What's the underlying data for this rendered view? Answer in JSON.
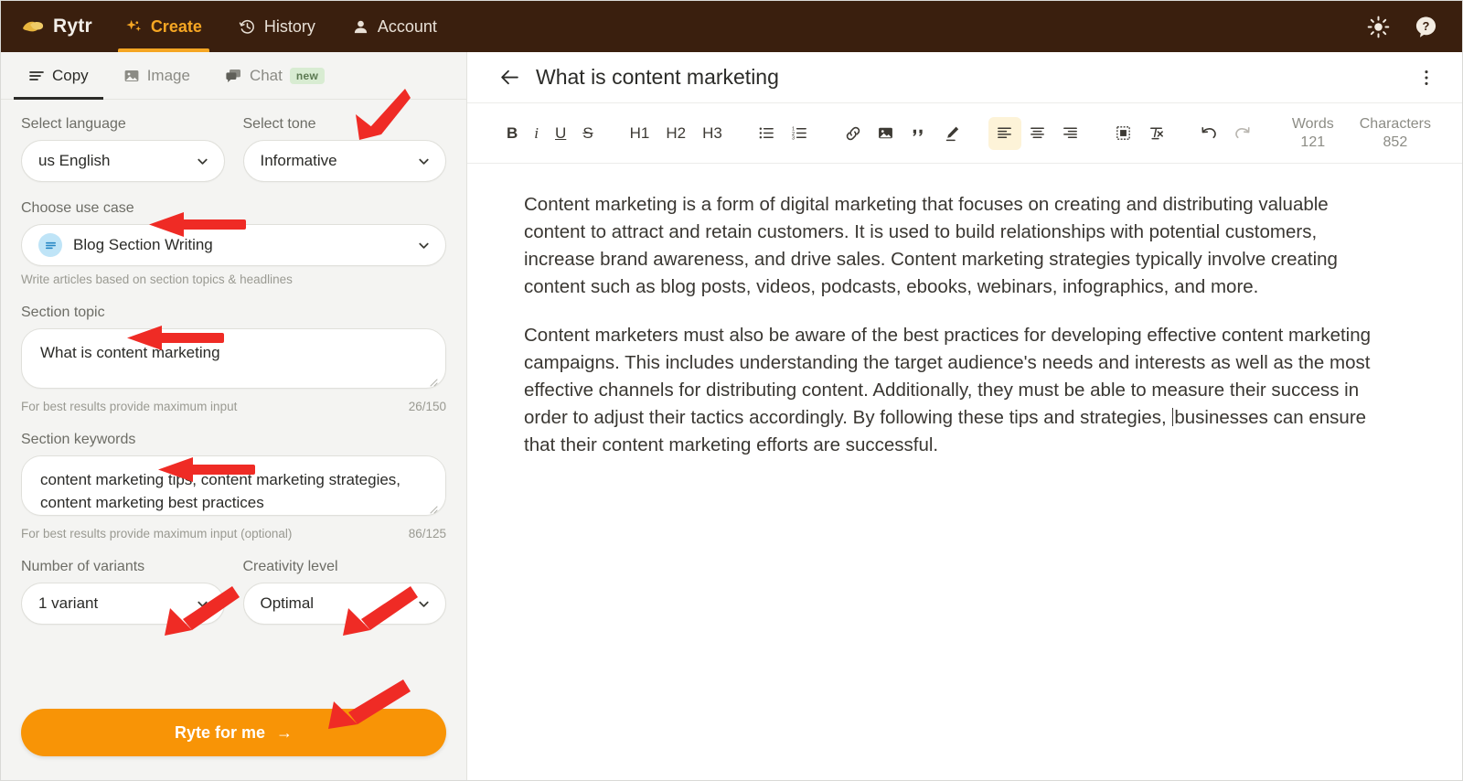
{
  "topnav": {
    "brand": "Rytr",
    "brand_icon": "rytr-logo-icon",
    "items": [
      {
        "label": "Create",
        "icon": "sparkle-icon",
        "active": true
      },
      {
        "label": "History",
        "icon": "clock-history-icon",
        "active": false
      },
      {
        "label": "Account",
        "icon": "person-icon",
        "active": false
      }
    ],
    "right_icons": [
      {
        "name": "sun-theme-icon"
      },
      {
        "name": "help-question-icon"
      }
    ]
  },
  "subtabs": [
    {
      "label": "Copy",
      "icon": "lines-icon",
      "active": true,
      "badge": ""
    },
    {
      "label": "Image",
      "icon": "picture-icon",
      "active": false,
      "badge": ""
    },
    {
      "label": "Chat",
      "icon": "chat-bubble-icon",
      "active": false,
      "badge": "new"
    }
  ],
  "form": {
    "language": {
      "label": "Select language",
      "value": "us English"
    },
    "tone": {
      "label": "Select tone",
      "value": "Informative"
    },
    "use_case": {
      "label": "Choose use case",
      "value": "Blog Section Writing",
      "icon": "blog-section-icon",
      "helper": "Write articles based on section topics & headlines"
    },
    "section_topic": {
      "label": "Section topic",
      "value": "What is content marketing",
      "placeholder": "What is content marketing",
      "helper": "For best results provide maximum input",
      "counter": "26/150"
    },
    "section_keywords": {
      "label": "Section keywords",
      "value": "content marketing tips, content marketing strategies, content marketing best practices",
      "placeholder": "content marketing tips, content marketing strategies",
      "helper": "For best results provide maximum input (optional)",
      "counter": "86/125"
    },
    "variants": {
      "label": "Number of variants",
      "value": "1 variant"
    },
    "creativity": {
      "label": "Creativity level",
      "value": "Optimal"
    },
    "submit": {
      "label": "Ryte for me",
      "arrow": "→",
      "color": "#f89406"
    }
  },
  "editor": {
    "back_icon": "back-arrow-icon",
    "title": "What is content marketing",
    "menu_icon": "kebab-menu-icon",
    "toolbar": [
      {
        "name": "bold-button",
        "label": "B",
        "kind": "bold",
        "active": false
      },
      {
        "name": "italic-button",
        "label": "i",
        "kind": "italic",
        "active": false
      },
      {
        "name": "underline-button",
        "label": "U",
        "kind": "under",
        "active": false
      },
      {
        "name": "strikethrough-button",
        "label": "S",
        "kind": "strike",
        "active": false
      },
      {
        "name": "heading-1-button",
        "label": "H1",
        "kind": "text",
        "active": false
      },
      {
        "name": "heading-2-button",
        "label": "H2",
        "kind": "text",
        "active": false
      },
      {
        "name": "heading-3-button",
        "label": "H3",
        "kind": "text",
        "active": false
      },
      {
        "name": "bulleted-list-button",
        "label": "",
        "kind": "icon-ul",
        "active": false
      },
      {
        "name": "numbered-list-button",
        "label": "",
        "kind": "icon-ol",
        "active": false
      },
      {
        "name": "insert-link-button",
        "label": "",
        "kind": "icon-link",
        "active": false
      },
      {
        "name": "insert-image-button",
        "label": "",
        "kind": "icon-image",
        "active": false
      },
      {
        "name": "blockquote-button",
        "label": "",
        "kind": "icon-quote",
        "active": false
      },
      {
        "name": "highlight-pen-button",
        "label": "",
        "kind": "icon-pen",
        "active": false
      },
      {
        "name": "align-left-button",
        "label": "",
        "kind": "icon-align-l",
        "active": true
      },
      {
        "name": "align-center-button",
        "label": "",
        "kind": "icon-align-c",
        "active": false
      },
      {
        "name": "align-right-button",
        "label": "",
        "kind": "icon-align-r",
        "active": false
      },
      {
        "name": "insert-table-button",
        "label": "",
        "kind": "icon-table",
        "active": false
      },
      {
        "name": "clear-format-button",
        "label": "",
        "kind": "icon-clear",
        "active": false
      },
      {
        "name": "undo-button",
        "label": "",
        "kind": "icon-undo",
        "active": false
      },
      {
        "name": "redo-button",
        "label": "",
        "kind": "icon-redo",
        "active": false
      }
    ],
    "counters": [
      {
        "label": "Words",
        "value": "121"
      },
      {
        "label": "Characters",
        "value": "852"
      }
    ],
    "paragraphs": [
      "Content marketing is a form of digital marketing that focuses on creating and distributing valuable content to attract and retain customers. It is used to build relationships with potential customers, increase brand awareness, and drive sales. Content marketing strategies typically involve creating content such as blog posts, videos, podcasts, ebooks, webinars, infographics, and more.",
      "Content marketers must also be aware of the best practices for developing effective content marketing campaigns. This includes understanding the target audience's needs and interests as well as the most effective channels for distributing content. Additionally, they must be able to measure their success in order to adjust their tactics accordingly. By following these tips and strategies, ",
      "businesses can ensure that their content marketing efforts are successful."
    ]
  },
  "annotations": {
    "color": "#ef2b25",
    "arrows": [
      {
        "name": "arrow-to-select-tone"
      },
      {
        "name": "arrow-to-choose-use-case"
      },
      {
        "name": "arrow-to-section-topic"
      },
      {
        "name": "arrow-to-section-keywords"
      },
      {
        "name": "arrow-to-number-of-variants"
      },
      {
        "name": "arrow-to-creativity-level"
      },
      {
        "name": "arrow-to-ryte-for-me-button"
      }
    ]
  }
}
